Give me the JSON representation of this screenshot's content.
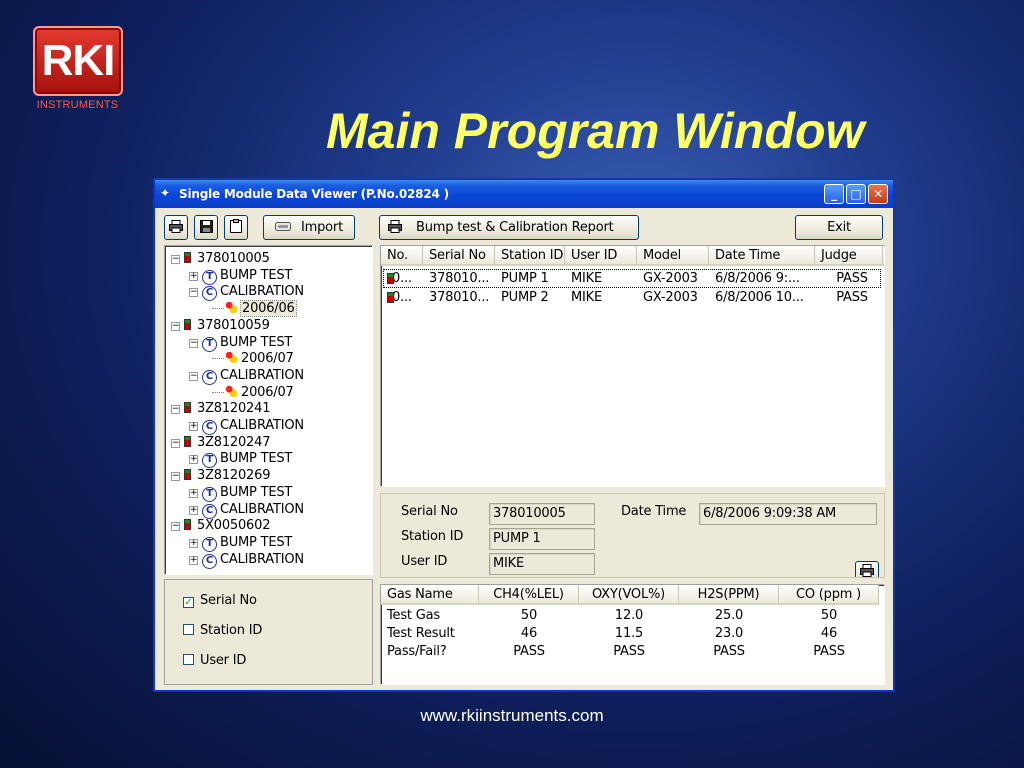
{
  "slide": {
    "logo_text": "RKI",
    "logo_sub": "INSTRUMENTS",
    "title": "Main Program Window",
    "footer_url": "www.rkiinstruments.com"
  },
  "window": {
    "title": "Single Module Data Viewer (P.No.02824 )",
    "title_buttons": [
      "minimize",
      "maximize",
      "close"
    ],
    "accent_color": "#0a46d6"
  },
  "toolbar": {
    "print_icon": "printer-icon",
    "save_icon": "floppy-icon",
    "clipboard_icon": "clipboard-icon",
    "import_label": "Import",
    "report_label": "Bump test & Calibration Report",
    "exit_label": "Exit"
  },
  "tree": {
    "units": [
      {
        "serial": "378010005",
        "children": [
          {
            "type": "T",
            "label": "BUMP TEST",
            "expanded": false,
            "dates": []
          },
          {
            "type": "C",
            "label": "CALIBRATION",
            "expanded": true,
            "dates": [
              "2006/06"
            ]
          }
        ]
      },
      {
        "serial": "378010059",
        "children": [
          {
            "type": "T",
            "label": "BUMP TEST",
            "expanded": true,
            "dates": [
              "2006/07"
            ]
          },
          {
            "type": "C",
            "label": "CALIBRATION",
            "expanded": true,
            "dates": [
              "2006/07"
            ]
          }
        ]
      },
      {
        "serial": "3Z8120241",
        "children": [
          {
            "type": "C",
            "label": "CALIBRATION",
            "expanded": false,
            "dates": []
          }
        ]
      },
      {
        "serial": "3Z8120247",
        "children": [
          {
            "type": "T",
            "label": "BUMP TEST",
            "expanded": false,
            "dates": []
          }
        ]
      },
      {
        "serial": "3Z8120269",
        "children": [
          {
            "type": "T",
            "label": "BUMP TEST",
            "expanded": false,
            "dates": []
          },
          {
            "type": "C",
            "label": "CALIBRATION",
            "expanded": false,
            "dates": []
          }
        ]
      },
      {
        "serial": "5X0050602",
        "children": [
          {
            "type": "T",
            "label": "BUMP TEST",
            "expanded": false,
            "dates": []
          },
          {
            "type": "C",
            "label": "CALIBRATION",
            "expanded": false,
            "dates": []
          }
        ]
      }
    ]
  },
  "filters": [
    {
      "label": "Serial No",
      "checked": true
    },
    {
      "label": "Station ID",
      "checked": false
    },
    {
      "label": "User ID",
      "checked": false
    }
  ],
  "list": {
    "columns": [
      "No.",
      "Serial No",
      "Station ID",
      "User ID",
      "Model",
      "Date Time",
      "Judge"
    ],
    "rows": [
      [
        "0...",
        "378010...",
        "PUMP 1",
        "MIKE",
        "GX-2003",
        "6/8/2006 9:...",
        "PASS"
      ],
      [
        "0...",
        "378010...",
        "PUMP 2",
        "MIKE",
        "GX-2003",
        "6/8/2006 10...",
        "PASS"
      ]
    ]
  },
  "detail": {
    "serial_label": "Serial No",
    "serial_value": "378010005",
    "station_label": "Station ID",
    "station_value": "PUMP 1",
    "user_label": "User ID",
    "user_value": "MIKE",
    "datetime_label": "Date Time",
    "datetime_value": "6/8/2006 9:09:38 AM",
    "print_icon": "printer-icon"
  },
  "gas_table": {
    "columns": [
      "Gas Name",
      "CH4(%LEL)",
      "OXY(VOL%)",
      "H2S(PPM)",
      "CO (ppm )"
    ],
    "rows": [
      [
        "Test Gas",
        "50",
        "12.0",
        "25.0",
        "50"
      ],
      [
        "Test Result",
        "46",
        "11.5",
        "23.0",
        "46"
      ],
      [
        "Pass/Fail?",
        "PASS",
        "PASS",
        "PASS",
        "PASS"
      ]
    ]
  }
}
